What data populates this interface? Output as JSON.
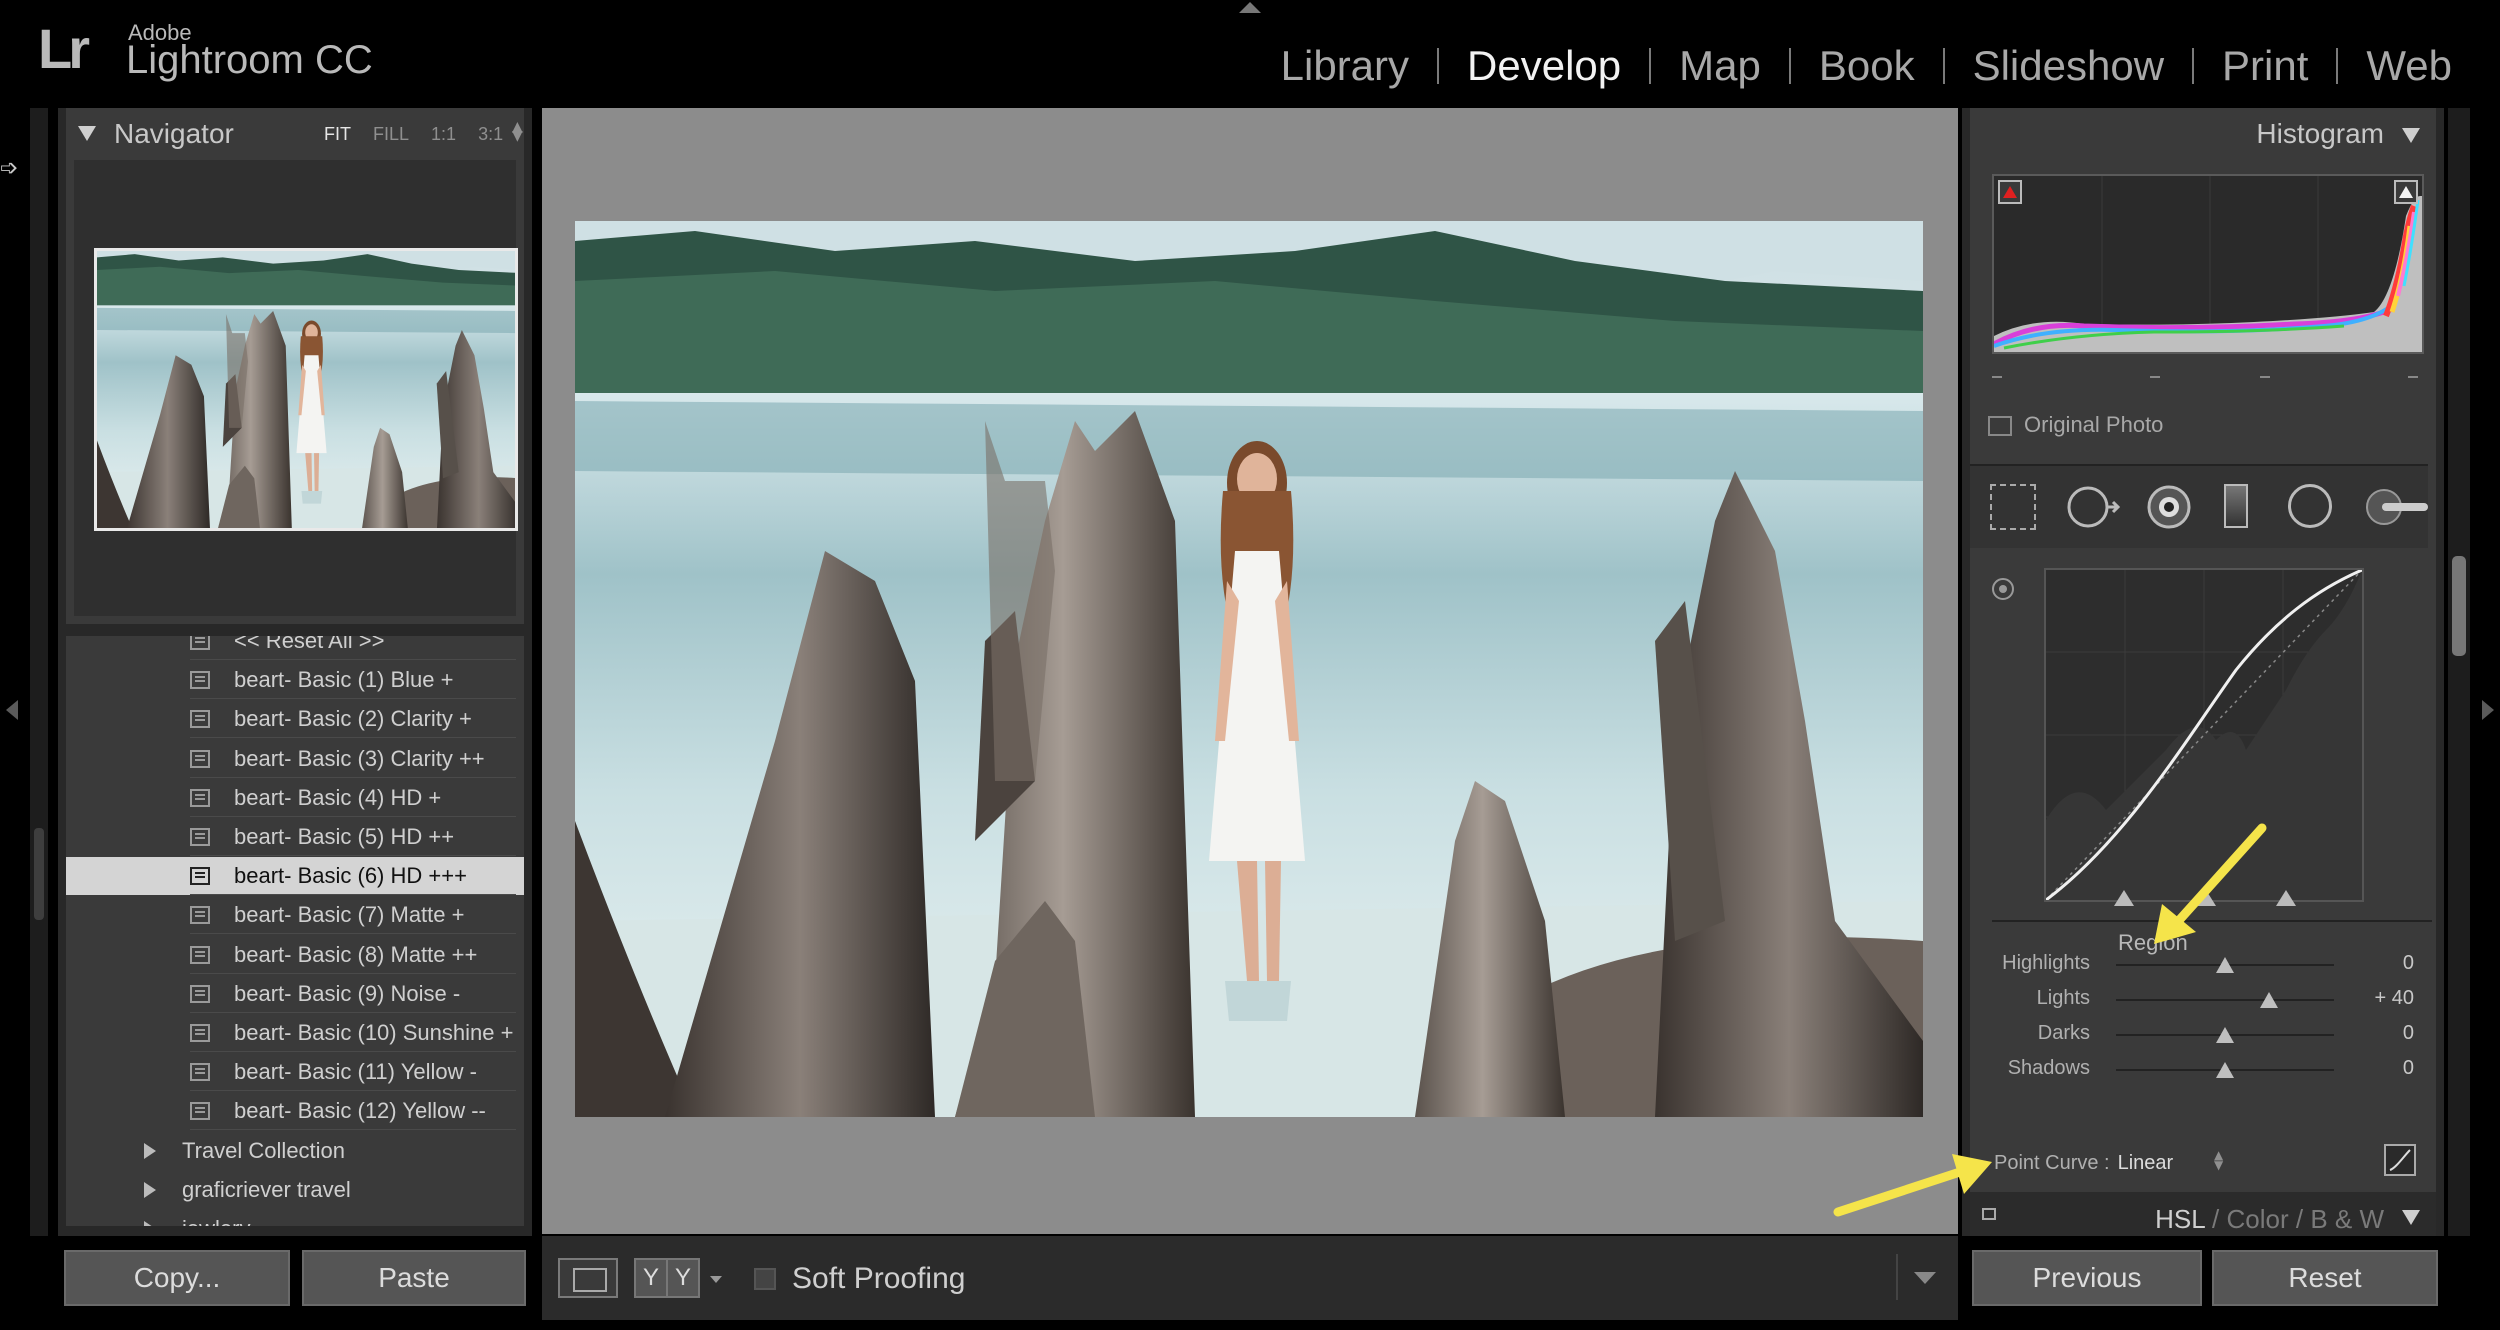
{
  "app": {
    "logo": "Lr",
    "brand_top": "Adobe",
    "brand_name": "Lightroom CC"
  },
  "modules": [
    {
      "label": "Library",
      "active": false
    },
    {
      "label": "Develop",
      "active": true
    },
    {
      "label": "Map",
      "active": false
    },
    {
      "label": "Book",
      "active": false
    },
    {
      "label": "Slideshow",
      "active": false
    },
    {
      "label": "Print",
      "active": false
    },
    {
      "label": "Web",
      "active": false
    }
  ],
  "navigator": {
    "title": "Navigator",
    "zoom_options": [
      "FIT",
      "FILL",
      "1:1",
      "3:1"
    ],
    "zoom_selected": "FIT"
  },
  "presets": {
    "items": [
      {
        "label": "<< Reset All >>",
        "selected": false
      },
      {
        "label": "beart- Basic (1) Blue +",
        "selected": false
      },
      {
        "label": "beart- Basic (2) Clarity +",
        "selected": false
      },
      {
        "label": "beart- Basic (3) Clarity ++",
        "selected": false
      },
      {
        "label": "beart- Basic (4) HD +",
        "selected": false
      },
      {
        "label": "beart- Basic (5) HD ++",
        "selected": false
      },
      {
        "label": "beart- Basic (6) HD +++",
        "selected": true
      },
      {
        "label": "beart- Basic (7) Matte +",
        "selected": false
      },
      {
        "label": "beart- Basic (8) Matte ++",
        "selected": false
      },
      {
        "label": "beart- Basic (9) Noise -",
        "selected": false
      },
      {
        "label": "beart- Basic (10) Sunshine +",
        "selected": false
      },
      {
        "label": "beart- Basic (11) Yellow -",
        "selected": false
      },
      {
        "label": "beart- Basic (12) Yellow --",
        "selected": false
      }
    ],
    "folders": [
      "Travel Collection",
      "graficriever travel",
      "jewlery"
    ]
  },
  "left_buttons": {
    "copy": "Copy...",
    "paste": "Paste"
  },
  "toolbar": {
    "yy_left": "Y",
    "yy_right": "Y",
    "soft_proofing": "Soft Proofing"
  },
  "histogram": {
    "title": "Histogram",
    "original_photo": "Original Photo"
  },
  "tone_curve": {
    "region_label": "Region",
    "sliders": [
      {
        "label": "Highlights",
        "value": "0",
        "level": 0
      },
      {
        "label": "Lights",
        "value": "+ 40",
        "level": 40
      },
      {
        "label": "Darks",
        "value": "0",
        "level": 0
      },
      {
        "label": "Shadows",
        "value": "0",
        "level": 0
      }
    ],
    "point_curve_label": "Point Curve :",
    "point_curve_value": "Linear"
  },
  "next_panel": {
    "hsl": "HSL",
    "sep": "/",
    "color": "Color",
    "bw": "B & W"
  },
  "right_buttons": {
    "previous": "Previous",
    "reset": "Reset"
  },
  "colors": {
    "accent_annotation": "#f5e44a",
    "panel": "#3a3a3a",
    "selected_row": "#d4d4d4"
  }
}
